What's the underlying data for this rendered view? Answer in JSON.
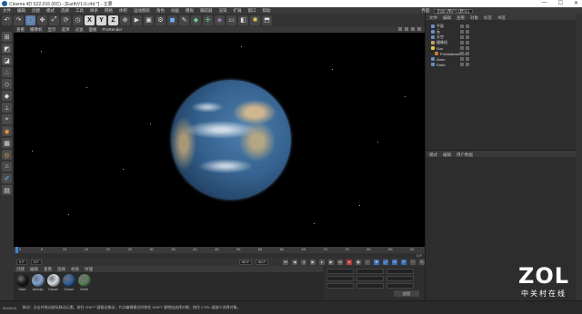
{
  "window": {
    "title": "Cinema 4D S22.016 (RC) - [EarthV1.0.c4d *] - 主要",
    "buttons": [
      "—",
      "☐",
      "✕"
    ]
  },
  "menubar": {
    "items": [
      "文件",
      "编辑",
      "创建",
      "模式",
      "选择",
      "工具",
      "样条",
      "网格",
      "体积",
      "运动图形",
      "角色",
      "动画",
      "模拟",
      "跟踪器",
      "渲染",
      "扩展",
      "窗口",
      "帮助"
    ],
    "layout_label": "界面:",
    "layout_value": "启动 (用户) (默认)"
  },
  "toolbar": {
    "icons": [
      "undo-icon",
      "redo-icon",
      "select-icon",
      "move-icon",
      "scale-icon",
      "rotate-icon",
      "recent-icon"
    ],
    "axes": [
      "X",
      "Y",
      "Z"
    ]
  },
  "viewport_menu": {
    "items": [
      "查看",
      "摄像机",
      "显示",
      "选项",
      "过滤",
      "面板",
      "ProRender"
    ]
  },
  "timeline": {
    "ticks": [
      "0",
      "5",
      "10",
      "15",
      "20",
      "25",
      "30",
      "35",
      "40",
      "45",
      "50",
      "55",
      "60",
      "65",
      "70",
      "75",
      "80",
      "85",
      "90"
    ],
    "end_label": "0 F"
  },
  "transport": {
    "start": "0 F",
    "current": "0 F",
    "end": "90 F",
    "end2": "90 F"
  },
  "material_menu": {
    "items": [
      "创建",
      "编辑",
      "查看",
      "选择",
      "材质",
      "纹理"
    ]
  },
  "materials": [
    {
      "name": "Stars",
      "color": "#1a1a1a"
    },
    {
      "name": "Atmosp",
      "color": "#7fa6d6"
    },
    {
      "name": "Clouds",
      "color": "#d9dde2"
    },
    {
      "name": "Ocean",
      "color": "#2f5f96"
    },
    {
      "name": "Earth",
      "color": "#5b7f5a"
    }
  ],
  "coords": {
    "apply_label": "应用"
  },
  "object_manager": {
    "tabs": [
      "文件",
      "编辑",
      "查看",
      "对象",
      "标签",
      "书签"
    ],
    "objects": [
      {
        "name": "平面",
        "color": "#6a8fc0"
      },
      {
        "name": "云",
        "color": "#6a8fc0"
      },
      {
        "name": "天空",
        "color": "#6a8fc0"
      },
      {
        "name": "摄像机",
        "color": "#c0a46a"
      },
      {
        "name": "Sun",
        "color": "#e0c050"
      },
      {
        "name": "ProMaterialSun",
        "color": "#c07a3a"
      },
      {
        "name": "Atmo",
        "color": "#6a8fc0"
      },
      {
        "name": "Earth",
        "color": "#6a8fc0"
      }
    ]
  },
  "attribute_manager": {
    "tabs": [
      "模式",
      "编辑",
      "用户数据"
    ]
  },
  "statusbar": {
    "time": "00:00:01",
    "hint": "移动：点击并拖动鼠标移动元素。按住 SHIFT 键量化移动；节点编辑模式时按住 SHIFT 键增加选择对象；按住 CTRL 键减少选择对象。"
  },
  "watermark": {
    "brand": "ZOL",
    "tagline": "中关村在线"
  }
}
